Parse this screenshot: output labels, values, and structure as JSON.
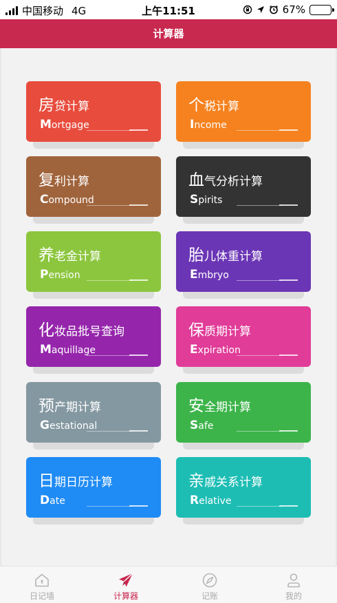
{
  "status_bar": {
    "carrier": "中国移动",
    "network": "4G",
    "time": "上午11:51",
    "battery": "67%",
    "battery_level": 0.67
  },
  "header": {
    "title": "计算器"
  },
  "cards": [
    {
      "cn_first": "房",
      "cn_rest": "贷计算",
      "en_first": "M",
      "en_rest": "ortgage",
      "color": "#e84c3d"
    },
    {
      "cn_first": "个",
      "cn_rest": "税计算",
      "en_first": "I",
      "en_rest": "ncome",
      "color": "#f5821f"
    },
    {
      "cn_first": "复",
      "cn_rest": "利计算",
      "en_first": "C",
      "en_rest": "ompound",
      "color": "#a0643c"
    },
    {
      "cn_first": "血",
      "cn_rest": "气分析计算",
      "en_first": "S",
      "en_rest": "pirits",
      "color": "#333333"
    },
    {
      "cn_first": "养",
      "cn_rest": "老金计算",
      "en_first": "P",
      "en_rest": "ension",
      "color": "#8cc63e"
    },
    {
      "cn_first": "胎",
      "cn_rest": "儿体重计算",
      "en_first": "E",
      "en_rest": "mbryo",
      "color": "#6b36b5"
    },
    {
      "cn_first": "化",
      "cn_rest": "妆品批号查询",
      "en_first": "M",
      "en_rest": "aquillage",
      "color": "#9526ab"
    },
    {
      "cn_first": "保",
      "cn_rest": "质期计算",
      "en_first": "E",
      "en_rest": "xpiration",
      "color": "#e03c98"
    },
    {
      "cn_first": "预",
      "cn_rest": "产期计算",
      "en_first": "G",
      "en_rest": "estational",
      "color": "#8498a1"
    },
    {
      "cn_first": "安",
      "cn_rest": "全期计算",
      "en_first": "S",
      "en_rest": "afe",
      "color": "#3cb44a"
    },
    {
      "cn_first": "日",
      "cn_rest": "期日历计算",
      "en_first": "D",
      "en_rest": "ate",
      "color": "#1f8bf5"
    },
    {
      "cn_first": "亲",
      "cn_rest": "戚关系计算",
      "en_first": "R",
      "en_rest": "elative",
      "color": "#1dbdb4"
    }
  ],
  "tabs": [
    {
      "label": "日记墙",
      "icon": "home-icon"
    },
    {
      "label": "计算器",
      "icon": "paper-plane-icon"
    },
    {
      "label": "记账",
      "icon": "compass-icon"
    },
    {
      "label": "我的",
      "icon": "person-icon"
    }
  ],
  "colors": {
    "accent": "#c8294f",
    "tab_inactive": "#aaaaaa"
  }
}
